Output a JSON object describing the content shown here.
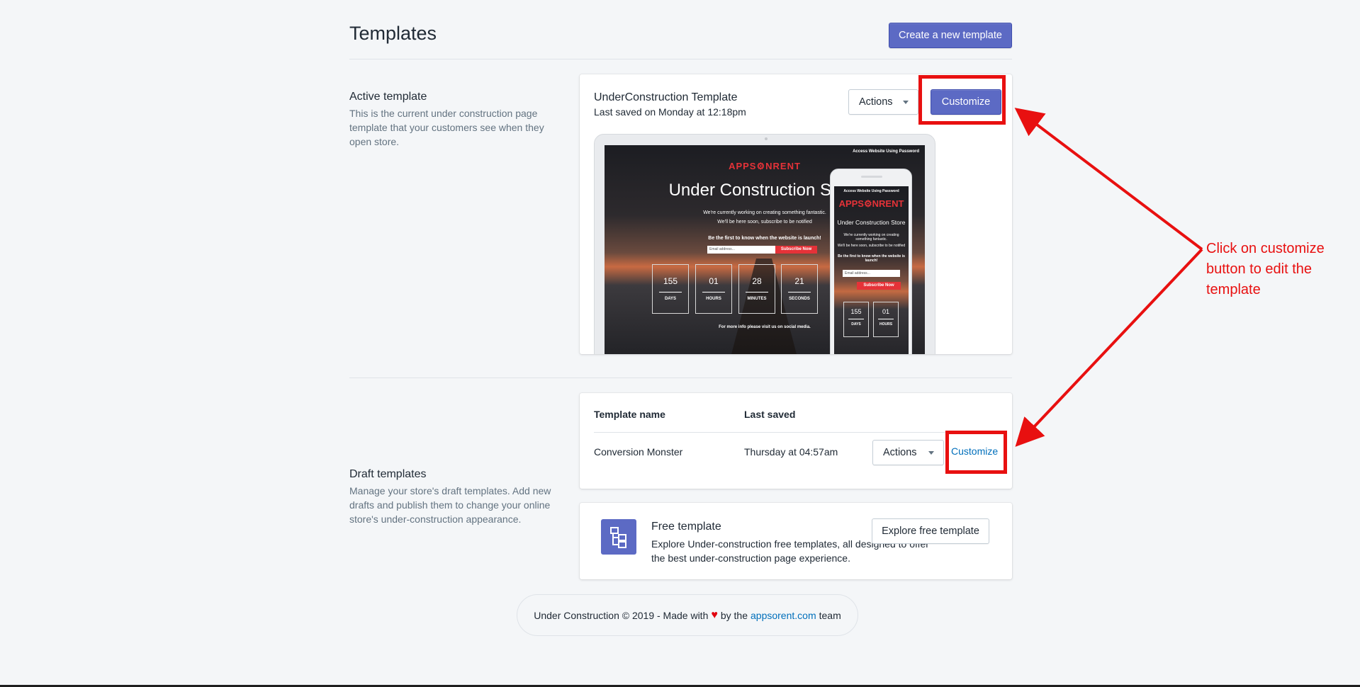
{
  "header": {
    "title": "Templates",
    "create_button": "Create a new template"
  },
  "active": {
    "section_title": "Active template",
    "section_desc": "This is the current under construction page template that your customers see when they open store.",
    "template_name": "UnderConstruction Template",
    "last_saved": "Last saved on Monday at 12:18pm",
    "actions_label": "Actions",
    "customize_label": "Customize"
  },
  "preview": {
    "desktop": {
      "top_link": "Access Website Using Password",
      "logo": "APPS⚙NRENT",
      "title": "Under Construction Store",
      "line1": "We're currently working on creating something fantastic.",
      "line2": "We'll be here soon, subscribe to be notified",
      "line3": "Be the first to know when the website is launch!",
      "email_placeholder": "Email address...",
      "subscribe": "Subscribe Now",
      "countdown": [
        {
          "value": "155",
          "label": "DAYS"
        },
        {
          "value": "01",
          "label": "HOURS"
        },
        {
          "value": "28",
          "label": "MINUTES"
        },
        {
          "value": "21",
          "label": "SECONDS"
        }
      ],
      "footer": "For more info please visit us on social media."
    },
    "mobile": {
      "top_link": "Access Website Using Password",
      "logo": "APPS⚙NRENT",
      "title": "Under Construction Store",
      "line1": "We're currently working on creating something fantastic.",
      "line2": "We'll be here soon, subscribe to be notified",
      "line3": "Be the first to know when the website is launch!",
      "email_placeholder": "Email address...",
      "subscribe": "Subscribe Now",
      "countdown": [
        {
          "value": "155",
          "label": "DAYS"
        },
        {
          "value": "01",
          "label": "HOURS"
        }
      ]
    }
  },
  "drafts": {
    "section_title": "Draft templates",
    "section_desc": "Manage your store's draft templates. Add new drafts and publish them to change your online store's under-construction appearance.",
    "col_name": "Template name",
    "col_saved": "Last saved",
    "rows": [
      {
        "name": "Conversion Monster",
        "saved": "Thursday at 04:57am",
        "actions": "Actions",
        "customize": "Customize"
      }
    ]
  },
  "free": {
    "title": "Free template",
    "desc": "Explore Under-construction free templates, all designed to offer the best under-construction page experience.",
    "button": "Explore free template"
  },
  "footer": {
    "prefix": "Under Construction © 2019 - Made with",
    "middle": "by the",
    "link": "appsorent.com",
    "suffix": "team"
  },
  "annotation": {
    "text": "Click on customize button to edit the template",
    "color": "#e81010"
  },
  "colors": {
    "primary": "#5c6ac4",
    "link": "#006fbb",
    "background": "#f4f6f8",
    "accent_red": "#e53238"
  }
}
